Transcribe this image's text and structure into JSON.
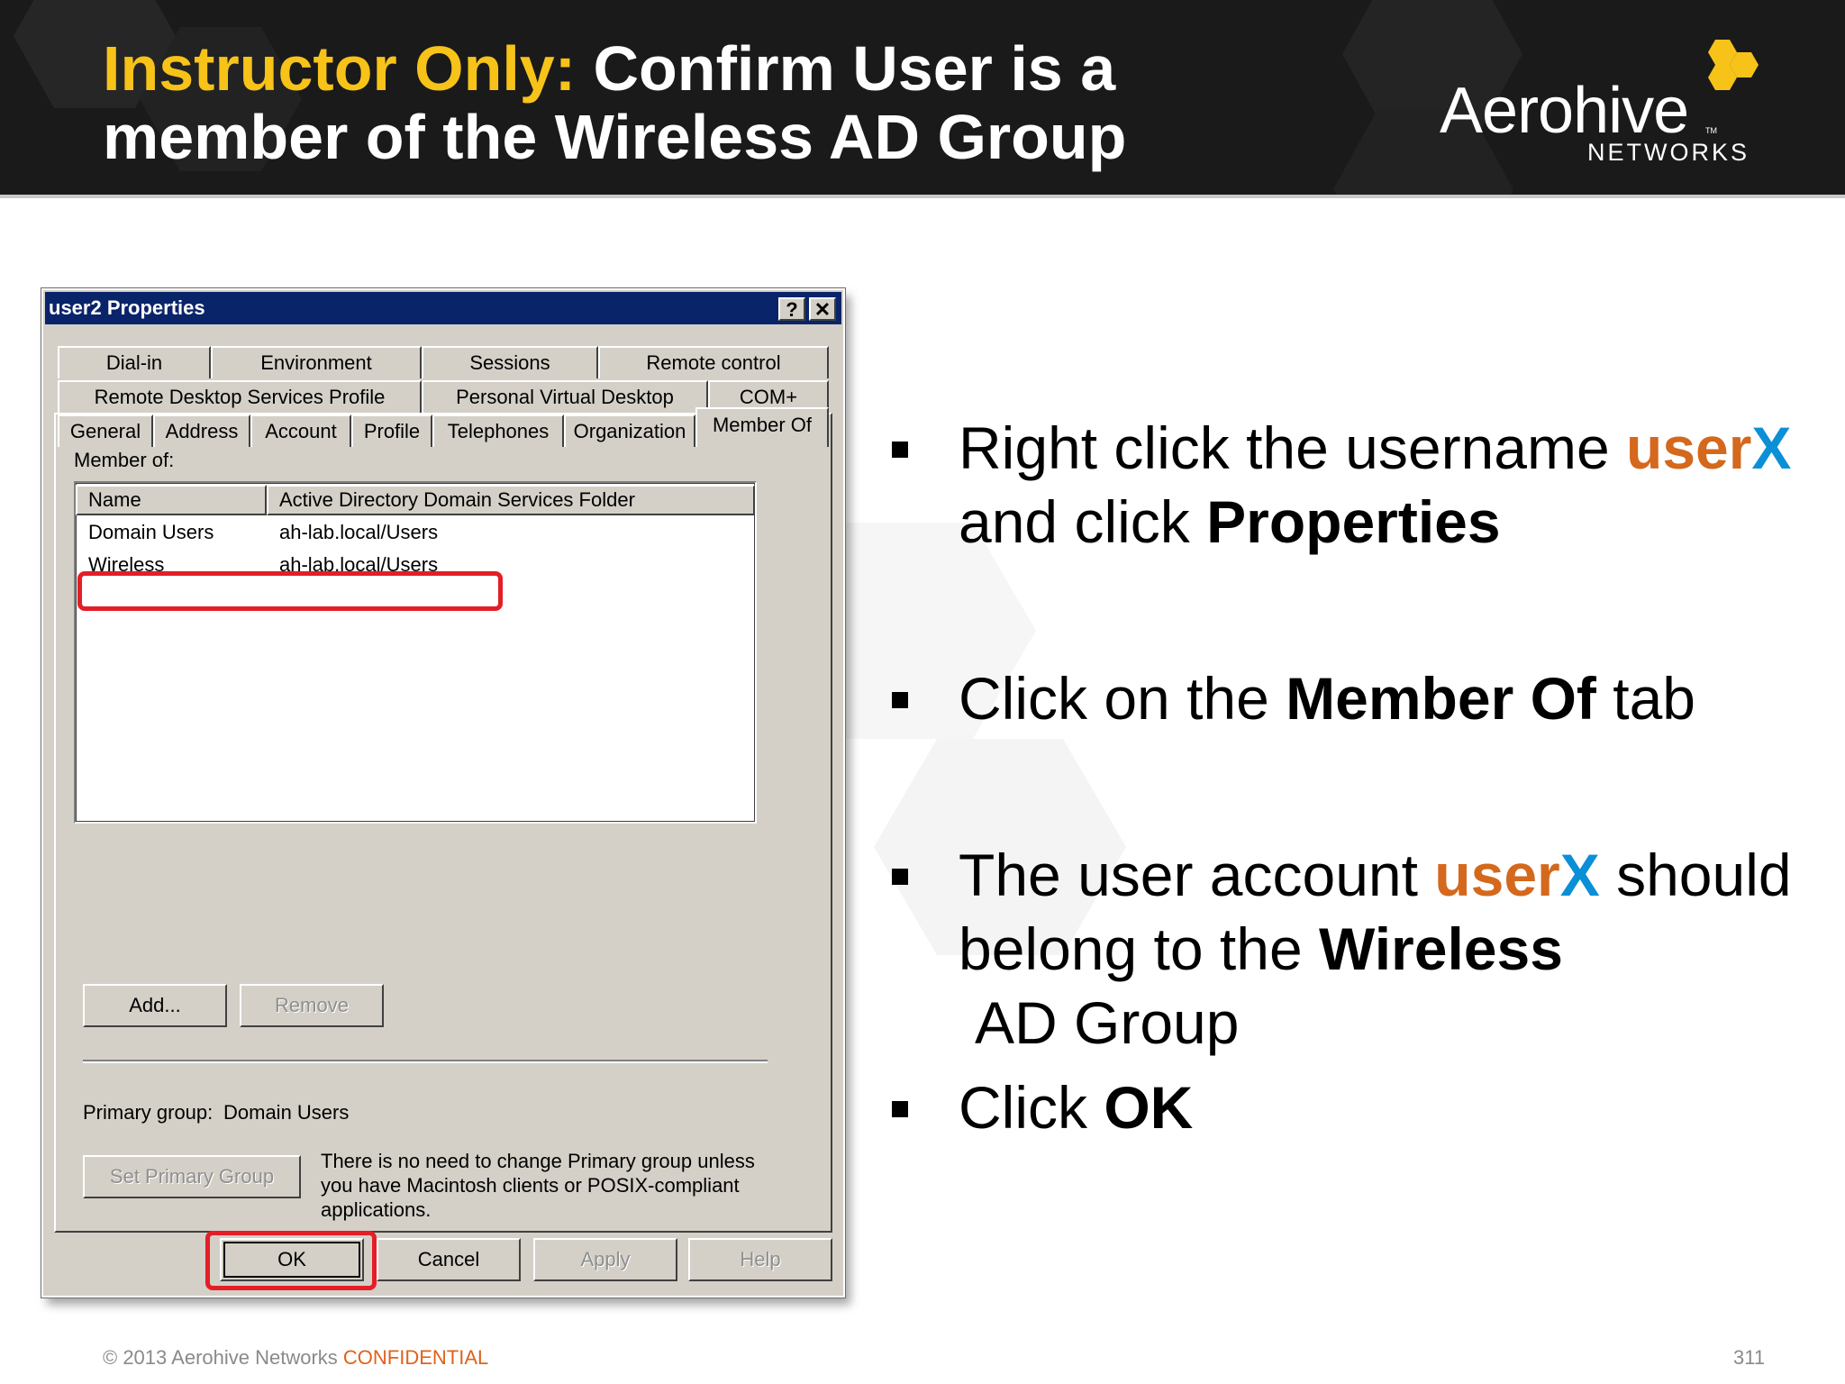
{
  "slide": {
    "title_accent": "Instructor Only:",
    "title_line1_rest": "Confirm User is a",
    "title_line2": "member of the Wireless AD Group",
    "logo_text": "Aerohive",
    "logo_tm": "TM",
    "logo_sub": "NETWORKS",
    "colors": {
      "accent_yellow": "#f7c319",
      "orange": "#d4681c",
      "blue": "#0b8fd6",
      "highlight_red": "#e41e26"
    }
  },
  "dialog": {
    "title": "user2 Properties",
    "help_btn": "?",
    "close_btn": "✕",
    "tabs_row1": [
      "Dial-in",
      "Environment",
      "Sessions",
      "Remote control"
    ],
    "tabs_row2": [
      "Remote Desktop Services Profile",
      "Personal Virtual Desktop",
      "COM+"
    ],
    "tabs_row3": [
      "General",
      "Address",
      "Account",
      "Profile",
      "Telephones",
      "Organization",
      "Member Of"
    ],
    "active_tab": "Member Of",
    "member_of_label": "Member of:",
    "columns": [
      "Name",
      "Active Directory Domain Services Folder"
    ],
    "rows": [
      {
        "name": "Domain Users",
        "folder": "ah-lab.local/Users"
      },
      {
        "name": "Wireless",
        "folder": "ah-lab.local/Users"
      }
    ],
    "add_btn": "Add...",
    "remove_btn": "Remove",
    "primary_group_label": "Primary group:",
    "primary_group_value": "Domain Users",
    "set_primary_btn": "Set Primary Group",
    "note_line1": "There is no need to change Primary group unless",
    "note_line2": "you have Macintosh clients or POSIX-compliant",
    "note_line3": "applications.",
    "ok_btn": "OK",
    "cancel_btn": "Cancel",
    "apply_btn": "Apply",
    "help_button": "Help"
  },
  "bullets": {
    "b1_pre": "Right click the username ",
    "b1_user": "user",
    "b1_x": "X",
    "b1_mid": "and click ",
    "b1_bold": "Properties",
    "b2_pre": "Click on the ",
    "b2_bold": "Member Of",
    "b2_post": " tab",
    "b3_pre": "The user account ",
    "b3_user": "user",
    "b3_x": "X",
    "b3_post": " should",
    "b3_line2_pre": "belong to the ",
    "b3_line2_bold": "Wireless",
    "b3_line3": "AD Group",
    "b4_pre": "Click ",
    "b4_bold": "OK"
  },
  "footer": {
    "copyright": "© 2013 Aerohive Networks ",
    "confidential": "CONFIDENTIAL",
    "page_number": "311"
  }
}
